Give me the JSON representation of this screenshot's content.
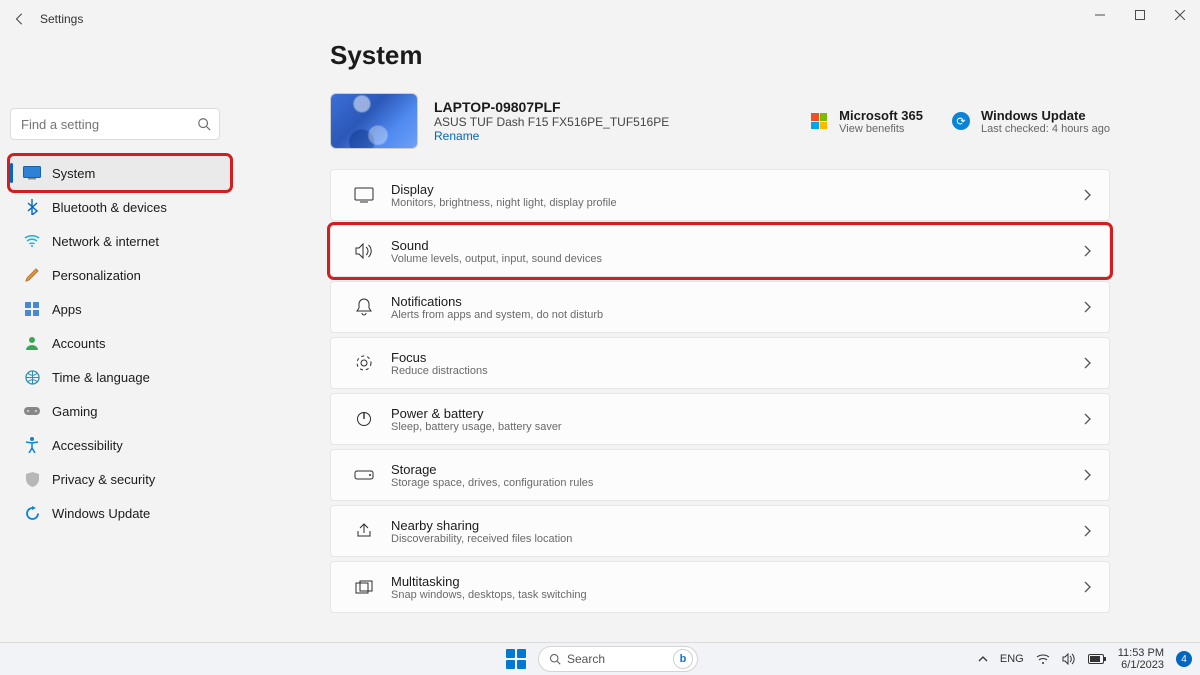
{
  "window": {
    "title": "Settings"
  },
  "search": {
    "placeholder": "Find a setting"
  },
  "sidebar": {
    "items": [
      {
        "id": "system",
        "label": "System"
      },
      {
        "id": "bluetooth",
        "label": "Bluetooth & devices"
      },
      {
        "id": "network",
        "label": "Network & internet"
      },
      {
        "id": "personalization",
        "label": "Personalization"
      },
      {
        "id": "apps",
        "label": "Apps"
      },
      {
        "id": "accounts",
        "label": "Accounts"
      },
      {
        "id": "time",
        "label": "Time & language"
      },
      {
        "id": "gaming",
        "label": "Gaming"
      },
      {
        "id": "accessibility",
        "label": "Accessibility"
      },
      {
        "id": "privacy",
        "label": "Privacy & security"
      },
      {
        "id": "update",
        "label": "Windows Update"
      }
    ]
  },
  "page": {
    "title": "System"
  },
  "device": {
    "name": "LAPTOP-09807PLF",
    "model": "ASUS TUF Dash F15 FX516PE_TUF516PE",
    "rename": "Rename"
  },
  "header_right": {
    "m365": {
      "title": "Microsoft 365",
      "sub": "View benefits"
    },
    "update": {
      "title": "Windows Update",
      "sub": "Last checked: 4 hours ago"
    }
  },
  "cards": [
    {
      "id": "display",
      "title": "Display",
      "sub": "Monitors, brightness, night light, display profile"
    },
    {
      "id": "sound",
      "title": "Sound",
      "sub": "Volume levels, output, input, sound devices"
    },
    {
      "id": "notifications",
      "title": "Notifications",
      "sub": "Alerts from apps and system, do not disturb"
    },
    {
      "id": "focus",
      "title": "Focus",
      "sub": "Reduce distractions"
    },
    {
      "id": "power",
      "title": "Power & battery",
      "sub": "Sleep, battery usage, battery saver"
    },
    {
      "id": "storage",
      "title": "Storage",
      "sub": "Storage space, drives, configuration rules"
    },
    {
      "id": "nearby",
      "title": "Nearby sharing",
      "sub": "Discoverability, received files location"
    },
    {
      "id": "multitask",
      "title": "Multitasking",
      "sub": "Snap windows, desktops, task switching"
    }
  ],
  "taskbar": {
    "search": "Search",
    "lang": "ENG",
    "time": "11:53 PM",
    "date": "6/1/2023",
    "notif": "4"
  }
}
